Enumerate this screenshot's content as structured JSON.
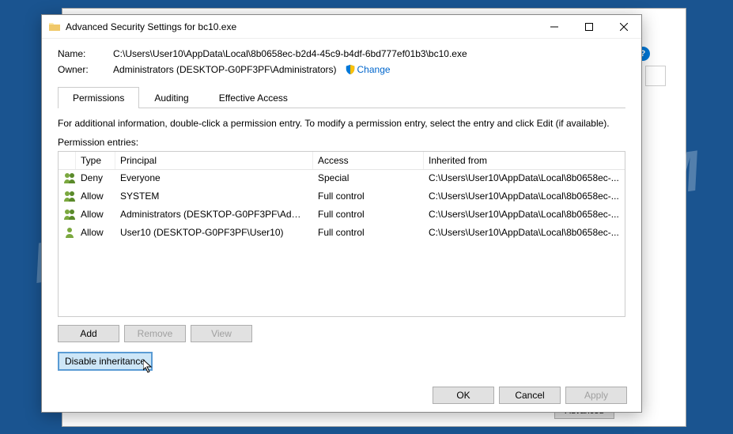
{
  "window": {
    "title": "Advanced Security Settings for bc10.exe"
  },
  "fields": {
    "name_label": "Name:",
    "name_value": "C:\\Users\\User10\\AppData\\Local\\8b0658ec-b2d4-45c9-b4df-6bd777ef01b3\\bc10.exe",
    "owner_label": "Owner:",
    "owner_value": "Administrators (DESKTOP-G0PF3PF\\Administrators)",
    "change_label": "Change"
  },
  "tabs": [
    {
      "label": "Permissions",
      "active": true
    },
    {
      "label": "Auditing",
      "active": false
    },
    {
      "label": "Effective Access",
      "active": false
    }
  ],
  "info_text": "For additional information, double-click a permission entry. To modify a permission entry, select the entry and click Edit (if available).",
  "entries_label": "Permission entries:",
  "columns": {
    "type": "Type",
    "principal": "Principal",
    "access": "Access",
    "inherited": "Inherited from"
  },
  "rows": [
    {
      "icon": "group",
      "type": "Deny",
      "principal": "Everyone",
      "access": "Special",
      "inherited": "C:\\Users\\User10\\AppData\\Local\\8b0658ec-..."
    },
    {
      "icon": "group",
      "type": "Allow",
      "principal": "SYSTEM",
      "access": "Full control",
      "inherited": "C:\\Users\\User10\\AppData\\Local\\8b0658ec-..."
    },
    {
      "icon": "group",
      "type": "Allow",
      "principal": "Administrators (DESKTOP-G0PF3PF\\Admini...",
      "access": "Full control",
      "inherited": "C:\\Users\\User10\\AppData\\Local\\8b0658ec-..."
    },
    {
      "icon": "user",
      "type": "Allow",
      "principal": "User10 (DESKTOP-G0PF3PF\\User10)",
      "access": "Full control",
      "inherited": "C:\\Users\\User10\\AppData\\Local\\8b0658ec-..."
    }
  ],
  "buttons": {
    "add": "Add",
    "remove": "Remove",
    "view": "View",
    "disable_inheritance": "Disable inheritance",
    "ok": "OK",
    "cancel": "Cancel",
    "apply": "Apply"
  },
  "background": {
    "advanced": "Advanced",
    "help": "?"
  },
  "watermark": "MYANTISPYWARE.COM"
}
